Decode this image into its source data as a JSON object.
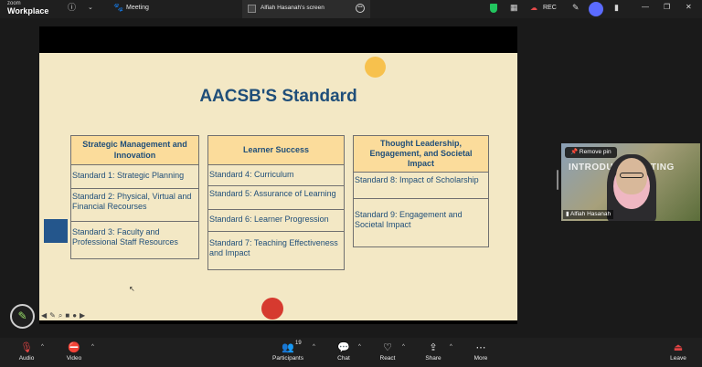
{
  "app": {
    "brand_small": "zoom",
    "brand_big": "Workplace"
  },
  "topbar": {
    "meeting_label": "Meeting",
    "screen_tab_label": "Alfiah Hasanah's screen",
    "rec_label": "REC",
    "colors": {
      "shield": "#22c55e",
      "rec": "#e64a4a"
    }
  },
  "slide": {
    "title": "AACSB'S Standard",
    "columns": [
      {
        "header": "Strategic Management and Innovation",
        "items": [
          "Standard 1: Strategic Planning",
          "Standard 2: Physical, Virtual and Financial Recourses",
          "Standard 3: Faculty and Professional Staff Resources"
        ]
      },
      {
        "header": "Learner Success",
        "items": [
          "Standard 4: Curriculum",
          "Standard 5: Assurance of Learning",
          "Standard 6: Learner Progression",
          "Standard 7: Teaching Effectiveness and Impact"
        ]
      },
      {
        "header": "Thought Leadership, Engagement, and Societal Impact",
        "items": [
          "Standard 8: Impact of Scholarship",
          "Standard 9: Engagement and Societal Impact"
        ]
      }
    ],
    "colors": {
      "background": "#f3e8c5",
      "header": "#fbdc9b",
      "text": "#1f4e79"
    }
  },
  "participant": {
    "remove_pin_label": "Remove pin",
    "name": "Alfiah Hasanah",
    "background_text": "INTRODUCT MEETING"
  },
  "toolbar": {
    "audio": "Audio",
    "video": "Video",
    "participants": "Participants",
    "participants_count": "19",
    "chat": "Chat",
    "react": "React",
    "share": "Share",
    "more": "More",
    "leave": "Leave"
  }
}
